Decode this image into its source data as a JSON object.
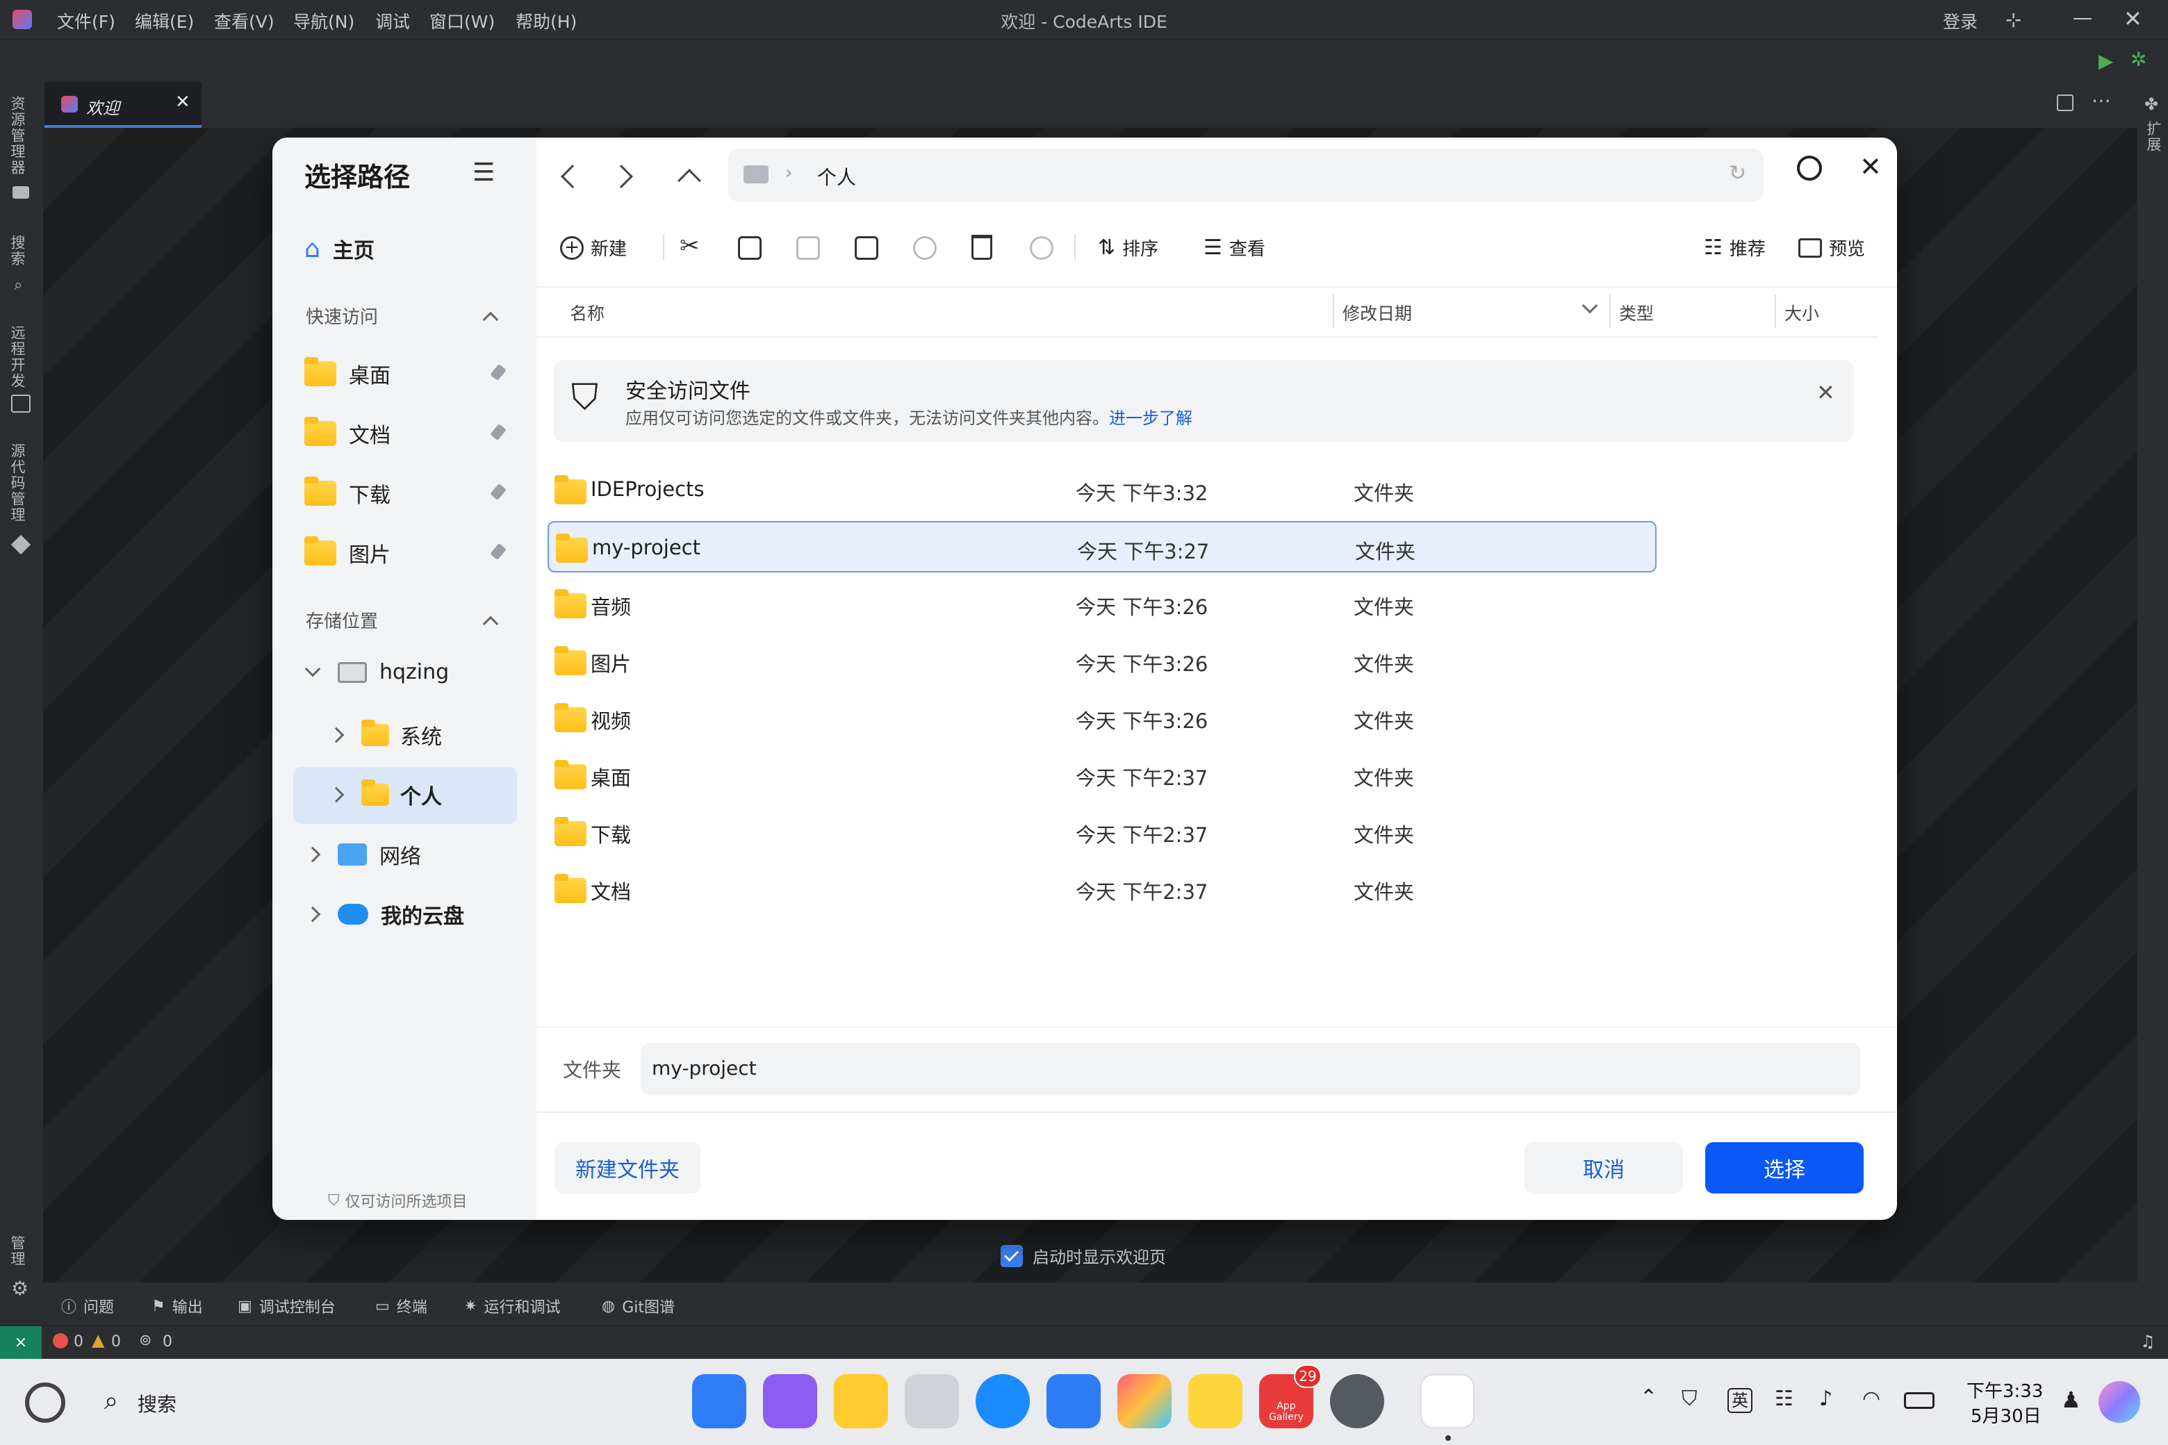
{
  "ide": {
    "window_title": "欢迎 - CodeArts IDE",
    "menus": [
      "文件(F)",
      "编辑(E)",
      "查看(V)",
      "导航(N)",
      "调试",
      "窗口(W)",
      "帮助(H)"
    ],
    "login": "登录",
    "left_activity": [
      "资源管理器",
      "搜索",
      "远程开发",
      "源代码管理",
      "管理"
    ],
    "right_activity": [
      "扩展"
    ],
    "tab_label": "欢迎",
    "panel_tabs": [
      "问题",
      "输出",
      "调试控制台",
      "终端",
      "运行和调试",
      "Git图谱"
    ],
    "status": {
      "errors": "0",
      "warnings": "0",
      "ports": "0"
    },
    "welcome_checkbox": "启动时显示欢迎页"
  },
  "dialog": {
    "title": "选择路径",
    "home": "主页",
    "quick_access_label": "快速访问",
    "quick_access": [
      "桌面",
      "文档",
      "下载",
      "图片"
    ],
    "storage_label": "存储位置",
    "device": "hqzing",
    "tree": [
      "系统",
      "个人"
    ],
    "network": "网络",
    "cloud": "我的云盘",
    "footer_note": "仅可访问所选项目",
    "breadcrumb": "个人",
    "toolbar": {
      "new": "新建",
      "sort": "排序",
      "view": "查看",
      "recommend": "推荐",
      "preview": "预览"
    },
    "columns": [
      "名称",
      "修改日期",
      "类型",
      "大小"
    ],
    "banner": {
      "title": "安全访问文件",
      "text": "应用仅可访问您选定的文件或文件夹，无法访问文件夹其他内容。",
      "link": "进一步了解"
    },
    "files": [
      {
        "name": "IDEProjects",
        "date": "今天 下午3:32",
        "type": "文件夹"
      },
      {
        "name": "my-project",
        "date": "今天 下午3:27",
        "type": "文件夹"
      },
      {
        "name": "音频",
        "date": "今天 下午3:26",
        "type": "文件夹"
      },
      {
        "name": "图片",
        "date": "今天 下午3:26",
        "type": "文件夹"
      },
      {
        "name": "视频",
        "date": "今天 下午3:26",
        "type": "文件夹"
      },
      {
        "name": "桌面",
        "date": "今天 下午2:37",
        "type": "文件夹"
      },
      {
        "name": "下载",
        "date": "今天 下午2:37",
        "type": "文件夹"
      },
      {
        "name": "文档",
        "date": "今天 下午2:37",
        "type": "文件夹"
      }
    ],
    "selected_index": 1,
    "folder_label": "文件夹",
    "folder_value": "my-project",
    "new_folder_button": "新建文件夹",
    "cancel_button": "取消",
    "select_button": "选择"
  },
  "taskbar": {
    "search": "搜索",
    "badge": "29",
    "appgallery": "App Gallery",
    "ime": "英",
    "time": "下午3:33",
    "date": "5月30日"
  },
  "colors": {
    "accent": "#0a59f7",
    "ide_bg": "#2b2d30",
    "selection": "#e8eefc"
  }
}
